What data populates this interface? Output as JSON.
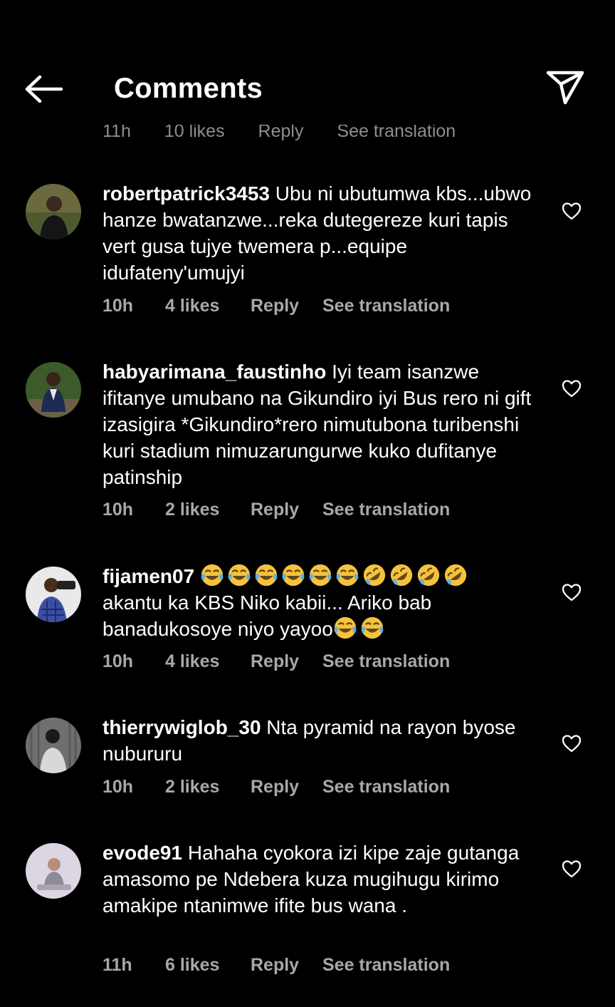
{
  "header": {
    "title": "Comments"
  },
  "ghost_row": {
    "time": "11h",
    "likes": "10 likes",
    "reply": "Reply",
    "translate": "See translation"
  },
  "comments": [
    {
      "username": "robertpatrick3453",
      "text": "Ubu ni ubutumwa kbs...ubwo hanze bwatanzwe...reka dutegereze kuri tapis vert gusa tujye twemera p...equipe idufateny'umujyi",
      "time": "10h",
      "likes": "4 likes",
      "reply": "Reply",
      "translate": "See translation"
    },
    {
      "username": "habyarimana_faustinho",
      "text": "Iyi team isanzwe ifitanye umubano na Gikundiro iyi Bus rero ni gift izasigira *Gikundiro*rero nimutubona turibenshi kuri stadium nimuzarungurwe kuko dufitanye patinship",
      "time": "10h",
      "likes": "2 likes",
      "reply": "Reply",
      "translate": "See translation"
    },
    {
      "username": "fijamen07",
      "text_line1_suffix": "",
      "text": "akantu ka KBS Niko kabii... Ariko bab banadukosoye niyo yayoo",
      "time": "10h",
      "likes": "4 likes",
      "reply": "Reply",
      "translate": "See translation"
    },
    {
      "username": "thierrywiglob_30",
      "text": "Nta pyramid na rayon byose nubururu",
      "time": "10h",
      "likes": "2 likes",
      "reply": "Reply",
      "translate": "See translation"
    },
    {
      "username": "evode91",
      "text": "Hahaha cyokora izi kipe zaje gutanga amasomo pe Ndebera kuza mugihugu kirimo amakipe ntanimwe ifite bus wana .",
      "time": "11h",
      "likes": "6 likes",
      "reply": "Reply",
      "translate": "See translation"
    }
  ],
  "icons": {
    "back": "back-arrow-icon",
    "share": "send-icon",
    "like": "heart-outline-icon",
    "laughing_emoji": "face-with-tears-of-joy",
    "rofl_emoji": "rolling-on-floor-laughing"
  },
  "colors": {
    "background": "#000000",
    "text": "#ffffff",
    "meta": "#a8a8a8"
  }
}
